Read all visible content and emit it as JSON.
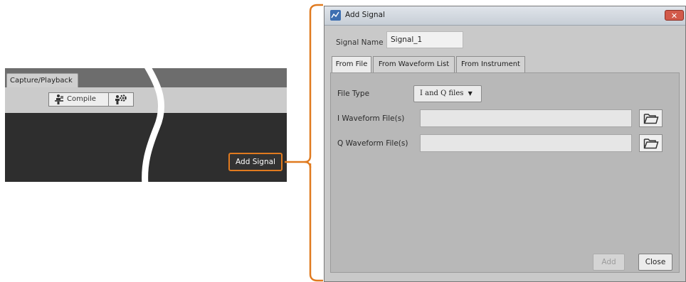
{
  "colors": {
    "accent": "#E07A1F",
    "dark_panel": "#2E2E2E",
    "dialog_bg": "#C9C9C9"
  },
  "left_panel": {
    "tab_label": "Capture/Playback",
    "compile_label": "Compile",
    "compile_icon": "compile-person-icon",
    "settings_icon": "gear-settings-icon",
    "add_signal_label": "Add Signal"
  },
  "dialog": {
    "title": "Add Signal",
    "app_icon": "app-icon",
    "close_icon": "close-x-icon",
    "signal_name_label": "Signal Name",
    "signal_name_value": "Signal_1",
    "tabs": [
      {
        "label": "From File",
        "active": true
      },
      {
        "label": "From Waveform List",
        "active": false
      },
      {
        "label": "From Instrument",
        "active": false
      }
    ],
    "file_type_label": "File Type",
    "file_type_value": "I and Q files",
    "i_waveform_label": "I Waveform File(s)",
    "i_waveform_value": "",
    "q_waveform_label": "Q Waveform File(s)",
    "q_waveform_value": "",
    "browse_icon": "folder-open-icon",
    "add_label": "Add",
    "add_enabled": false,
    "close_label": "Close"
  }
}
